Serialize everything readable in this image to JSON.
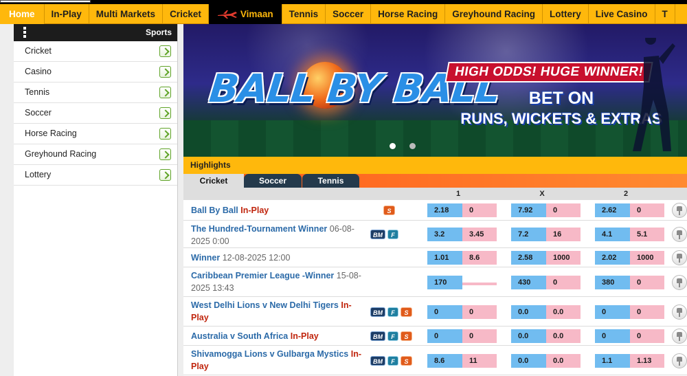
{
  "nav": {
    "items": [
      "Home",
      "In-Play",
      "Multi Markets",
      "Cricket",
      "Vimaan",
      "Tennis",
      "Soccer",
      "Horse Racing",
      "Greyhound Racing",
      "Lottery",
      "Live Casino",
      "T"
    ]
  },
  "sidebar": {
    "header": "Sports",
    "items": [
      "Cricket",
      "Casino",
      "Tennis",
      "Soccer",
      "Horse Racing",
      "Greyhound Racing",
      "Lottery"
    ]
  },
  "banner": {
    "title": "BALL BY BALL",
    "tagline": "HIGH ODDS! HUGE WINNER!",
    "cta_line1": "BET ON",
    "cta_line2": "RUNS, WICKETS & EXTRAS",
    "slides": 2,
    "active_slide": 1
  },
  "highlights": {
    "title": "Highlights",
    "tabs": [
      "Cricket",
      "Soccer",
      "Tennis"
    ],
    "active_tab": "Cricket",
    "columns": [
      "1",
      "X",
      "2"
    ]
  },
  "events": [
    {
      "name": "Ball By Ball",
      "inplay": "In-Play",
      "date": "",
      "badges": [
        "S"
      ],
      "odds": [
        "2.18",
        "0",
        "7.92",
        "0",
        "2.62",
        "0"
      ]
    },
    {
      "name": "The Hundred-Tournament Winner",
      "inplay": "",
      "date": "06-08-2025 0:00",
      "badges": [
        "BM",
        "F"
      ],
      "odds": [
        "3.2",
        "3.45",
        "7.2",
        "16",
        "4.1",
        "5.1"
      ]
    },
    {
      "name": "Winner",
      "inplay": "",
      "date": "12-08-2025 12:00",
      "badges": [],
      "odds": [
        "1.01",
        "8.6",
        "2.58",
        "1000",
        "2.02",
        "1000"
      ]
    },
    {
      "name": "Caribbean Premier League -Winner",
      "inplay": "",
      "date": "15-08-2025 13:43",
      "badges": [],
      "odds": [
        "170",
        "",
        "430",
        "0",
        "380",
        "0"
      ]
    },
    {
      "name": "West Delhi Lions v New Delhi Tigers",
      "inplay": "In-Play",
      "date": "",
      "badges": [
        "BM",
        "F",
        "S"
      ],
      "odds": [
        "0",
        "0",
        "0.0",
        "0.0",
        "0",
        "0"
      ]
    },
    {
      "name": "Australia v South Africa",
      "inplay": "In-Play",
      "date": "",
      "badges": [
        "BM",
        "F",
        "S"
      ],
      "odds": [
        "0",
        "0",
        "0.0",
        "0.0",
        "0",
        "0"
      ]
    },
    {
      "name": "Shivamogga Lions v Gulbarga Mystics",
      "inplay": "In-Play",
      "date": "",
      "badges": [
        "BM",
        "F",
        "S"
      ],
      "odds": [
        "8.6",
        "11",
        "0.0",
        "0.0",
        "1.1",
        "1.13"
      ]
    }
  ],
  "colors": {
    "nav_bg": "#ffb80c",
    "back": "#71bcf0",
    "lay": "#f7b9c7",
    "event_link": "#2b6aa8",
    "inplay": "#c0250d",
    "tab_dark": "#243a4c"
  }
}
